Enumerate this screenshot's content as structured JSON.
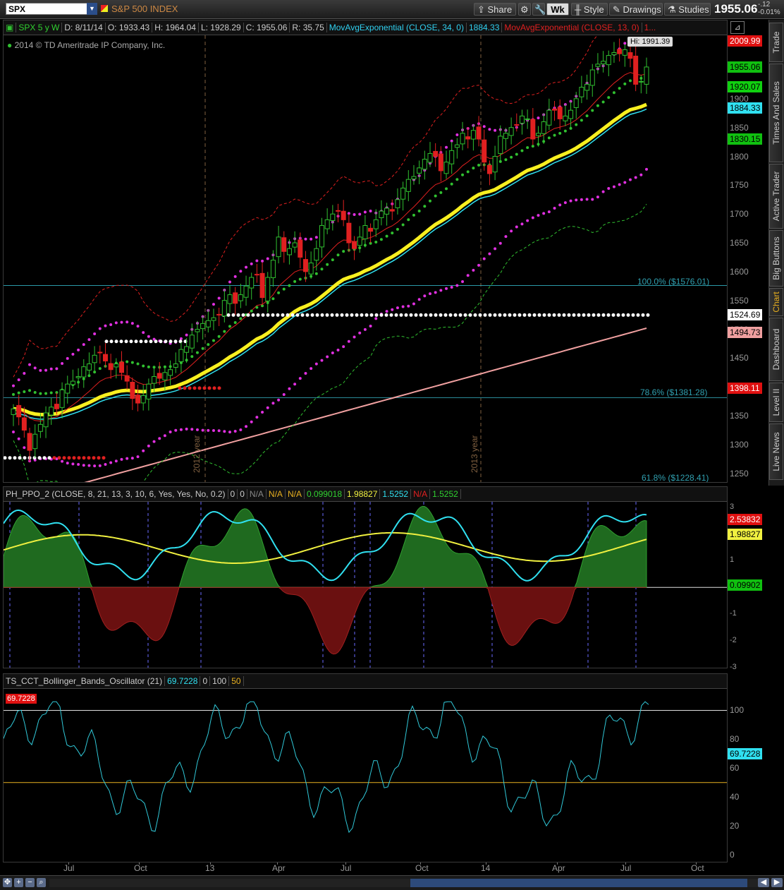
{
  "toolbar": {
    "symbol": "SPX",
    "index_name": "S&P 500 INDEX",
    "share_label": "Share",
    "wk_label": "Wk",
    "style_label": "Style",
    "drawings_label": "Drawings",
    "studies_label": "Studies",
    "last_price": "1955.06",
    "change_abs": "-.12",
    "change_pct": "-0.01%"
  },
  "right_tabs": [
    {
      "label": "Trade",
      "active": false
    },
    {
      "label": "Times And Sales",
      "active": false
    },
    {
      "label": "Active Trader",
      "active": false
    },
    {
      "label": "Big Buttons",
      "active": false
    },
    {
      "label": "Chart",
      "active": true
    },
    {
      "label": "Dashboard",
      "active": false
    },
    {
      "label": "Level II",
      "active": false
    },
    {
      "label": "Live News",
      "active": false
    }
  ],
  "price_pane": {
    "legend": {
      "symbol_period": "SPX 5 y W",
      "date": "D: 8/11/14",
      "open": "O: 1933.43",
      "high": "H: 1964.04",
      "low": "L: 1928.29",
      "close": "C: 1955.06",
      "range": "R: 35.75",
      "ema34_label": "MovAvgExponential (CLOSE, 34, 0)",
      "ema34_value": "1884.33",
      "ema13_label": "MovAvgExponential (CLOSE, 13, 0)",
      "ema13_more": "1..."
    },
    "copyright": "2014 © TD Ameritrade IP Company, Inc.",
    "hi_tag": "Hi: 1991.39",
    "fib_100": "100.0%  ($1576.01)",
    "fib_786": "78.6%  ($1381.28)",
    "fib_618": "61.8%  ($1228.41)",
    "year_2012": "2012 year",
    "year_2013": "2013 year",
    "y_ticks": [
      "2000",
      "1950",
      "1900",
      "1850",
      "1800",
      "1750",
      "1700",
      "1650",
      "1600",
      "1550",
      "1500",
      "1450",
      "1400",
      "1350",
      "1300",
      "1250"
    ],
    "y_range": [
      1235,
      2010
    ],
    "price_tags": [
      {
        "value": "2009.99",
        "price": 2009.99,
        "bg": "#e01010",
        "fg": "#ffffff"
      },
      {
        "value": "1955.06",
        "price": 1955.06,
        "bg": "#10c010",
        "fg": "#000000"
      },
      {
        "value": "1920.07",
        "price": 1920.07,
        "bg": "#10d010",
        "fg": "#000000"
      },
      {
        "value": "1884.33",
        "price": 1884.33,
        "bg": "#30e0f0",
        "fg": "#000000"
      },
      {
        "value": "1830.15",
        "price": 1830.15,
        "bg": "#10c010",
        "fg": "#000000"
      },
      {
        "value": "1524.69",
        "price": 1524.69,
        "bg": "#ffffff",
        "fg": "#000000"
      },
      {
        "value": "1494.73",
        "price": 1494.73,
        "bg": "#f0a0a0",
        "fg": "#000000"
      },
      {
        "value": "1398.11",
        "price": 1398.11,
        "bg": "#e01010",
        "fg": "#ffffff"
      }
    ]
  },
  "ppo_pane": {
    "legend": [
      "PH_PPO_2 (CLOSE, 8, 21, 13, 3, 10, 6, Yes, Yes, No, 0.2)",
      "0",
      "0",
      "N/A",
      "N/A",
      "N/A",
      "0.099018",
      "1.98827",
      "1.5252",
      "N/A",
      "1.5252"
    ],
    "legend_colors": [
      "#cccccc",
      "#cccccc",
      "#cccccc",
      "#888888",
      "#e8b020",
      "#e8b020",
      "#30d030",
      "#f0f040",
      "#30e0f0",
      "#e02020",
      "#30d030"
    ],
    "y_ticks": [
      "3",
      "2",
      "1",
      "-1",
      "-2",
      "-3"
    ],
    "y_range": [
      -3,
      3.2
    ],
    "tags": [
      {
        "value": "2.53832",
        "v": 2.53832,
        "bg": "#e01010",
        "fg": "#ffffff"
      },
      {
        "value": "1.98827",
        "v": 1.98827,
        "bg": "#f0f040",
        "fg": "#000000"
      },
      {
        "value": "0.09902",
        "v": 0.09902,
        "bg": "#10c010",
        "fg": "#000000"
      }
    ]
  },
  "bb_pane": {
    "legend": [
      "TS_CCT_Bollinger_Bands_Oscillator (21)",
      "69.7228",
      "0",
      "100",
      "50"
    ],
    "legend_colors": [
      "#cccccc",
      "#30e0f0",
      "#cccccc",
      "#cccccc",
      "#e8b020"
    ],
    "corner_tag": "69.7228",
    "y_ticks": [
      "100",
      "80",
      "60",
      "40",
      "20",
      "0"
    ],
    "y_range": [
      0,
      110
    ],
    "tag_value": "69.7228",
    "tag_v": 69.7228
  },
  "x_axis": {
    "labels": [
      {
        "text": "Jul",
        "x": 97
      },
      {
        "text": "Oct",
        "x": 197
      },
      {
        "text": "13",
        "x": 298
      },
      {
        "text": "Apr",
        "x": 393
      },
      {
        "text": "Jul",
        "x": 490
      },
      {
        "text": "Oct",
        "x": 596
      },
      {
        "text": "14",
        "x": 689
      },
      {
        "text": "Apr",
        "x": 790
      },
      {
        "text": "Jul",
        "x": 887
      },
      {
        "text": "Oct",
        "x": 987
      }
    ]
  },
  "bottom_bar": {
    "zoom_in": "+",
    "zoom_out": "−"
  },
  "colors": {
    "bull": "#30c030",
    "bear": "#e02020",
    "ema34": "#30e0f0",
    "ema_thick": "#f8f020",
    "ema13": "#e02020",
    "band_outer": "#e02020",
    "band_dots": "#e030e0",
    "band_green": "#30c030",
    "sma_pink": "#f0a0a0",
    "ppo_line": "#30e0f0",
    "ppo_signal": "#f0f040",
    "hist_pos": "#1f6a1f",
    "hist_neg": "#6a1010",
    "bb_line": "#30c8d8"
  },
  "chart_data": {
    "type": "candlestick",
    "symbol": "SPX",
    "period": "Weekly",
    "x_labels": [
      "Jul",
      "Oct",
      "13",
      "Apr",
      "Jul",
      "Oct",
      "14",
      "Apr",
      "Jul",
      "Oct"
    ],
    "closes": [
      1362,
      1348,
      1325,
      1290,
      1318,
      1335,
      1355,
      1365,
      1362,
      1395,
      1405,
      1410,
      1418,
      1435,
      1440,
      1455,
      1460,
      1445,
      1430,
      1440,
      1425,
      1410,
      1380,
      1372,
      1385,
      1405,
      1418,
      1415,
      1425,
      1430,
      1440,
      1465,
      1470,
      1490,
      1500,
      1510,
      1515,
      1520,
      1525,
      1550,
      1560,
      1545,
      1560,
      1575,
      1590,
      1595,
      1555,
      1590,
      1620,
      1660,
      1635,
      1640,
      1650,
      1625,
      1600,
      1615,
      1640,
      1680,
      1690,
      1700,
      1705,
      1690,
      1650,
      1640,
      1660,
      1680,
      1670,
      1690,
      1705,
      1710,
      1705,
      1725,
      1745,
      1760,
      1765,
      1780,
      1795,
      1805,
      1800,
      1775,
      1790,
      1810,
      1820,
      1840,
      1830,
      1845,
      1830,
      1790,
      1770,
      1800,
      1835,
      1840,
      1850,
      1855,
      1870,
      1865,
      1830,
      1840,
      1860,
      1880,
      1880,
      1865,
      1870,
      1880,
      1900,
      1920,
      1925,
      1950,
      1960,
      1965,
      1975,
      1980,
      1978,
      1985,
      1970,
      1925,
      1930,
      1955
    ]
  }
}
